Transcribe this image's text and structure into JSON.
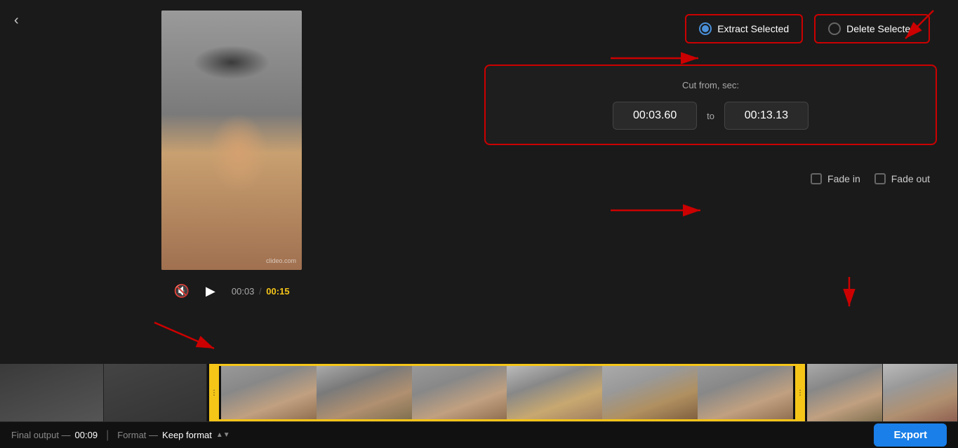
{
  "app": {
    "back_label": "‹"
  },
  "actions": {
    "extract_label": "Extract Selected",
    "delete_label": "Delete Selected",
    "extract_selected": true
  },
  "cut": {
    "label": "Cut from, sec:",
    "from_value": "00:03.60",
    "to_label": "to",
    "to_value": "00:13.13"
  },
  "fade": {
    "fade_in_label": "Fade in",
    "fade_out_label": "Fade out"
  },
  "controls": {
    "mute_icon": "🔇",
    "play_icon": "▶",
    "current_time": "00:03",
    "separator": "/",
    "total_time": "00:15"
  },
  "video": {
    "watermark": "clideo.com"
  },
  "bottom": {
    "final_output_label": "Final output —",
    "duration": "00:09",
    "format_label": "Format —",
    "format_value": "Keep format",
    "export_label": "Export"
  }
}
